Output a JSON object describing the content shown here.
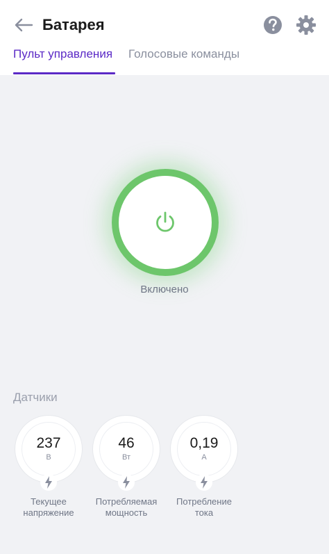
{
  "header": {
    "title": "Батарея",
    "icons": {
      "back": "arrow-left-icon",
      "help": "question-circle-icon",
      "settings": "gear-icon"
    }
  },
  "tabs": [
    {
      "label": "Пульт управления",
      "active": true
    },
    {
      "label": "Голосовые команды",
      "active": false
    }
  ],
  "power": {
    "status": "Включено",
    "on": true,
    "icon": "power-icon",
    "accent_color": "#6dc66b"
  },
  "sensors": {
    "title": "Датчики",
    "items": [
      {
        "value": "237",
        "unit": "В",
        "label_line1": "Текущее",
        "label_line2": "напряжение",
        "icon": "bolt-icon"
      },
      {
        "value": "46",
        "unit": "Вт",
        "label_line1": "Потребляемая",
        "label_line2": "мощность",
        "icon": "bolt-icon"
      },
      {
        "value": "0,19",
        "unit": "А",
        "label_line1": "Потребление",
        "label_line2": "тока",
        "icon": "bolt-icon"
      }
    ]
  },
  "colors": {
    "accent": "#5b2ac6",
    "power_green": "#6dc66b",
    "background": "#f1f2f5",
    "icon_gray": "#8a8f9e"
  }
}
